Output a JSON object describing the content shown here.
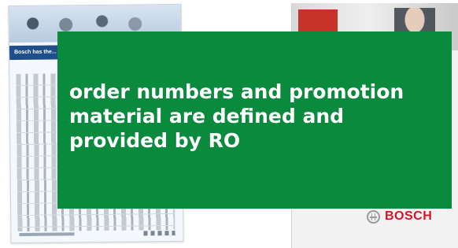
{
  "background_documents": {
    "left": {
      "name": "product catalog poster",
      "band_text": "Bosch has the...",
      "accent_color": "#1e4f8a"
    },
    "right": {
      "name": "promotion brochure",
      "logo_text": "BOSCH",
      "logo_color": "#d3152b",
      "accent_color": "#c7332b"
    }
  },
  "callout": {
    "text": "order numbers and promotion material are defined and provided by RO",
    "background_color": "#0a8a3c",
    "text_color": "#ffffff"
  }
}
